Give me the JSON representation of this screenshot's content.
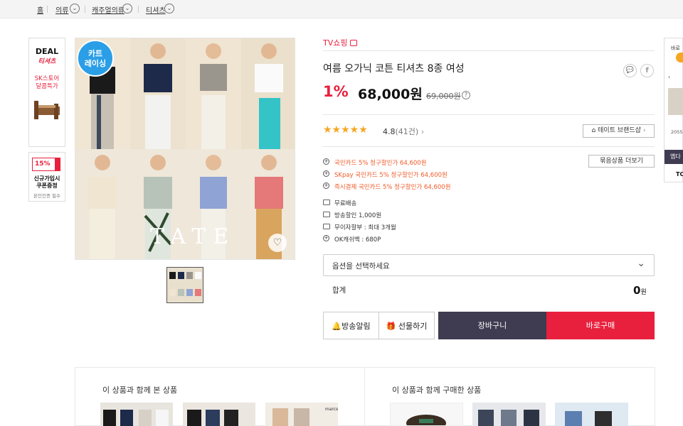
{
  "breadcrumb": [
    "홈",
    "의류",
    "캐주얼의류",
    "티셔츠"
  ],
  "left_ads": {
    "deal_title": "DEAL",
    "deal_sub": "티셔츠",
    "deal_store": "SK스토어\n달콤특가",
    "coupon_percent": "15%",
    "coupon_text": "신규가입시\n쿠폰증정",
    "coupon_note": "본인인증 필수"
  },
  "product_badge": "카트\n레이싱",
  "watermark": "TATE",
  "seller": "TV쇼핑",
  "title": "여름 오가닉 코튼 티셔츠 8종 여성",
  "discount": "1%",
  "price": "68,000원",
  "original_price": "69,000원",
  "rating": {
    "stars": 5,
    "score": "4.8",
    "count": "(41건)"
  },
  "brand_button": "테이트 브랜드샵",
  "more_button": "묶음상품 더보기",
  "benefits": [
    "국민카드 5% 청구할인가 64,600원",
    "SKpay 국민카드 5% 청구할인가 64,600원",
    "즉시결제 국민카드 5% 청구할인가 64,600원"
  ],
  "info": [
    "무료배송",
    "방송할인 1,000원",
    "무이자할부 : 최대 3개월",
    "OK캐쉬백 : 680P"
  ],
  "option_placeholder": "옵션을 선택하세요",
  "total_label": "합계",
  "total_value": "0",
  "total_unit": "원",
  "buttons": {
    "alert": "방송알림",
    "gift": "선물하기",
    "cart": "장바구니",
    "buy": "바로구매"
  },
  "colors": {
    "accent": "#e8203d",
    "dark": "#3f3c51",
    "benefit": "#f05a28"
  },
  "rec_left_title": "이 상품과 함께 본 상품",
  "rec_right_title": "이 상품과 함께 구매한 상품",
  "right_rail": {
    "top_text": "바로",
    "price_hint": "2055",
    "tab": "앱다",
    "tc": "TC"
  }
}
